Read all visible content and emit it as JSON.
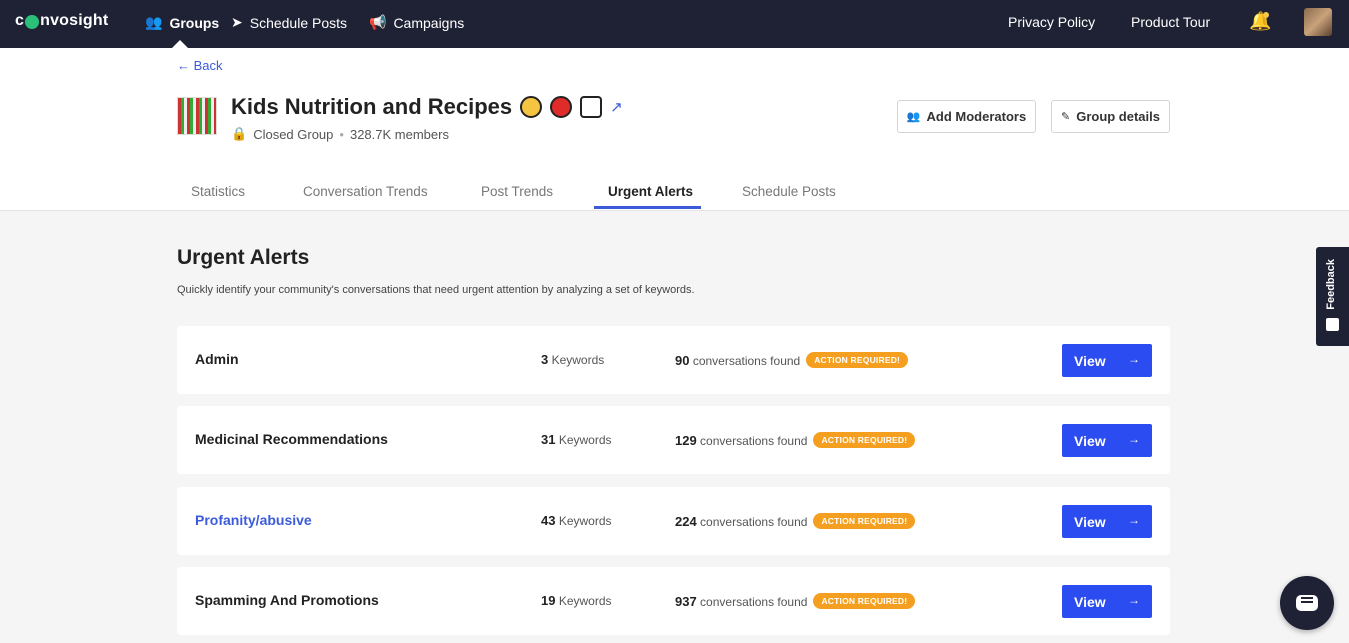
{
  "nav": {
    "logo": "convosight",
    "items": [
      {
        "label": "Groups",
        "icon": "groups-icon",
        "active": true
      },
      {
        "label": "Schedule Posts",
        "icon": "send-icon",
        "active": false
      },
      {
        "label": "Campaigns",
        "icon": "megaphone-icon",
        "active": false
      }
    ],
    "privacy": "Privacy Policy",
    "tour": "Product Tour"
  },
  "header": {
    "back": "← Back",
    "group_name": "Kids Nutrition and Recipes",
    "privacy_label": "Closed Group",
    "members": "328.7K members",
    "add_moderators": "Add Moderators",
    "group_details": "Group details"
  },
  "tabs": [
    "Statistics",
    "Conversation Trends",
    "Post Trends",
    "Urgent Alerts",
    "Schedule Posts"
  ],
  "main": {
    "title": "Urgent Alerts",
    "description": "Quickly identify your community's conversations that need urgent attention by analyzing a set of keywords.",
    "keywords_label": "Keywords",
    "conversations_label": "conversations found",
    "badge": "ACTION REQUIRED!",
    "view_label": "View",
    "alerts": [
      {
        "name": "Admin",
        "keywords": "3",
        "conversations": "90"
      },
      {
        "name": "Medicinal Recommendations",
        "keywords": "31",
        "conversations": "129"
      },
      {
        "name": "Profanity/abusive",
        "keywords": "43",
        "conversations": "224"
      },
      {
        "name": "Spamming And Promotions",
        "keywords": "19",
        "conversations": "937"
      }
    ]
  },
  "feedback": "Feedback",
  "colors": {
    "nav_bg": "#1f2235",
    "accent": "#2b4cf0",
    "badge": "#f59f20"
  }
}
